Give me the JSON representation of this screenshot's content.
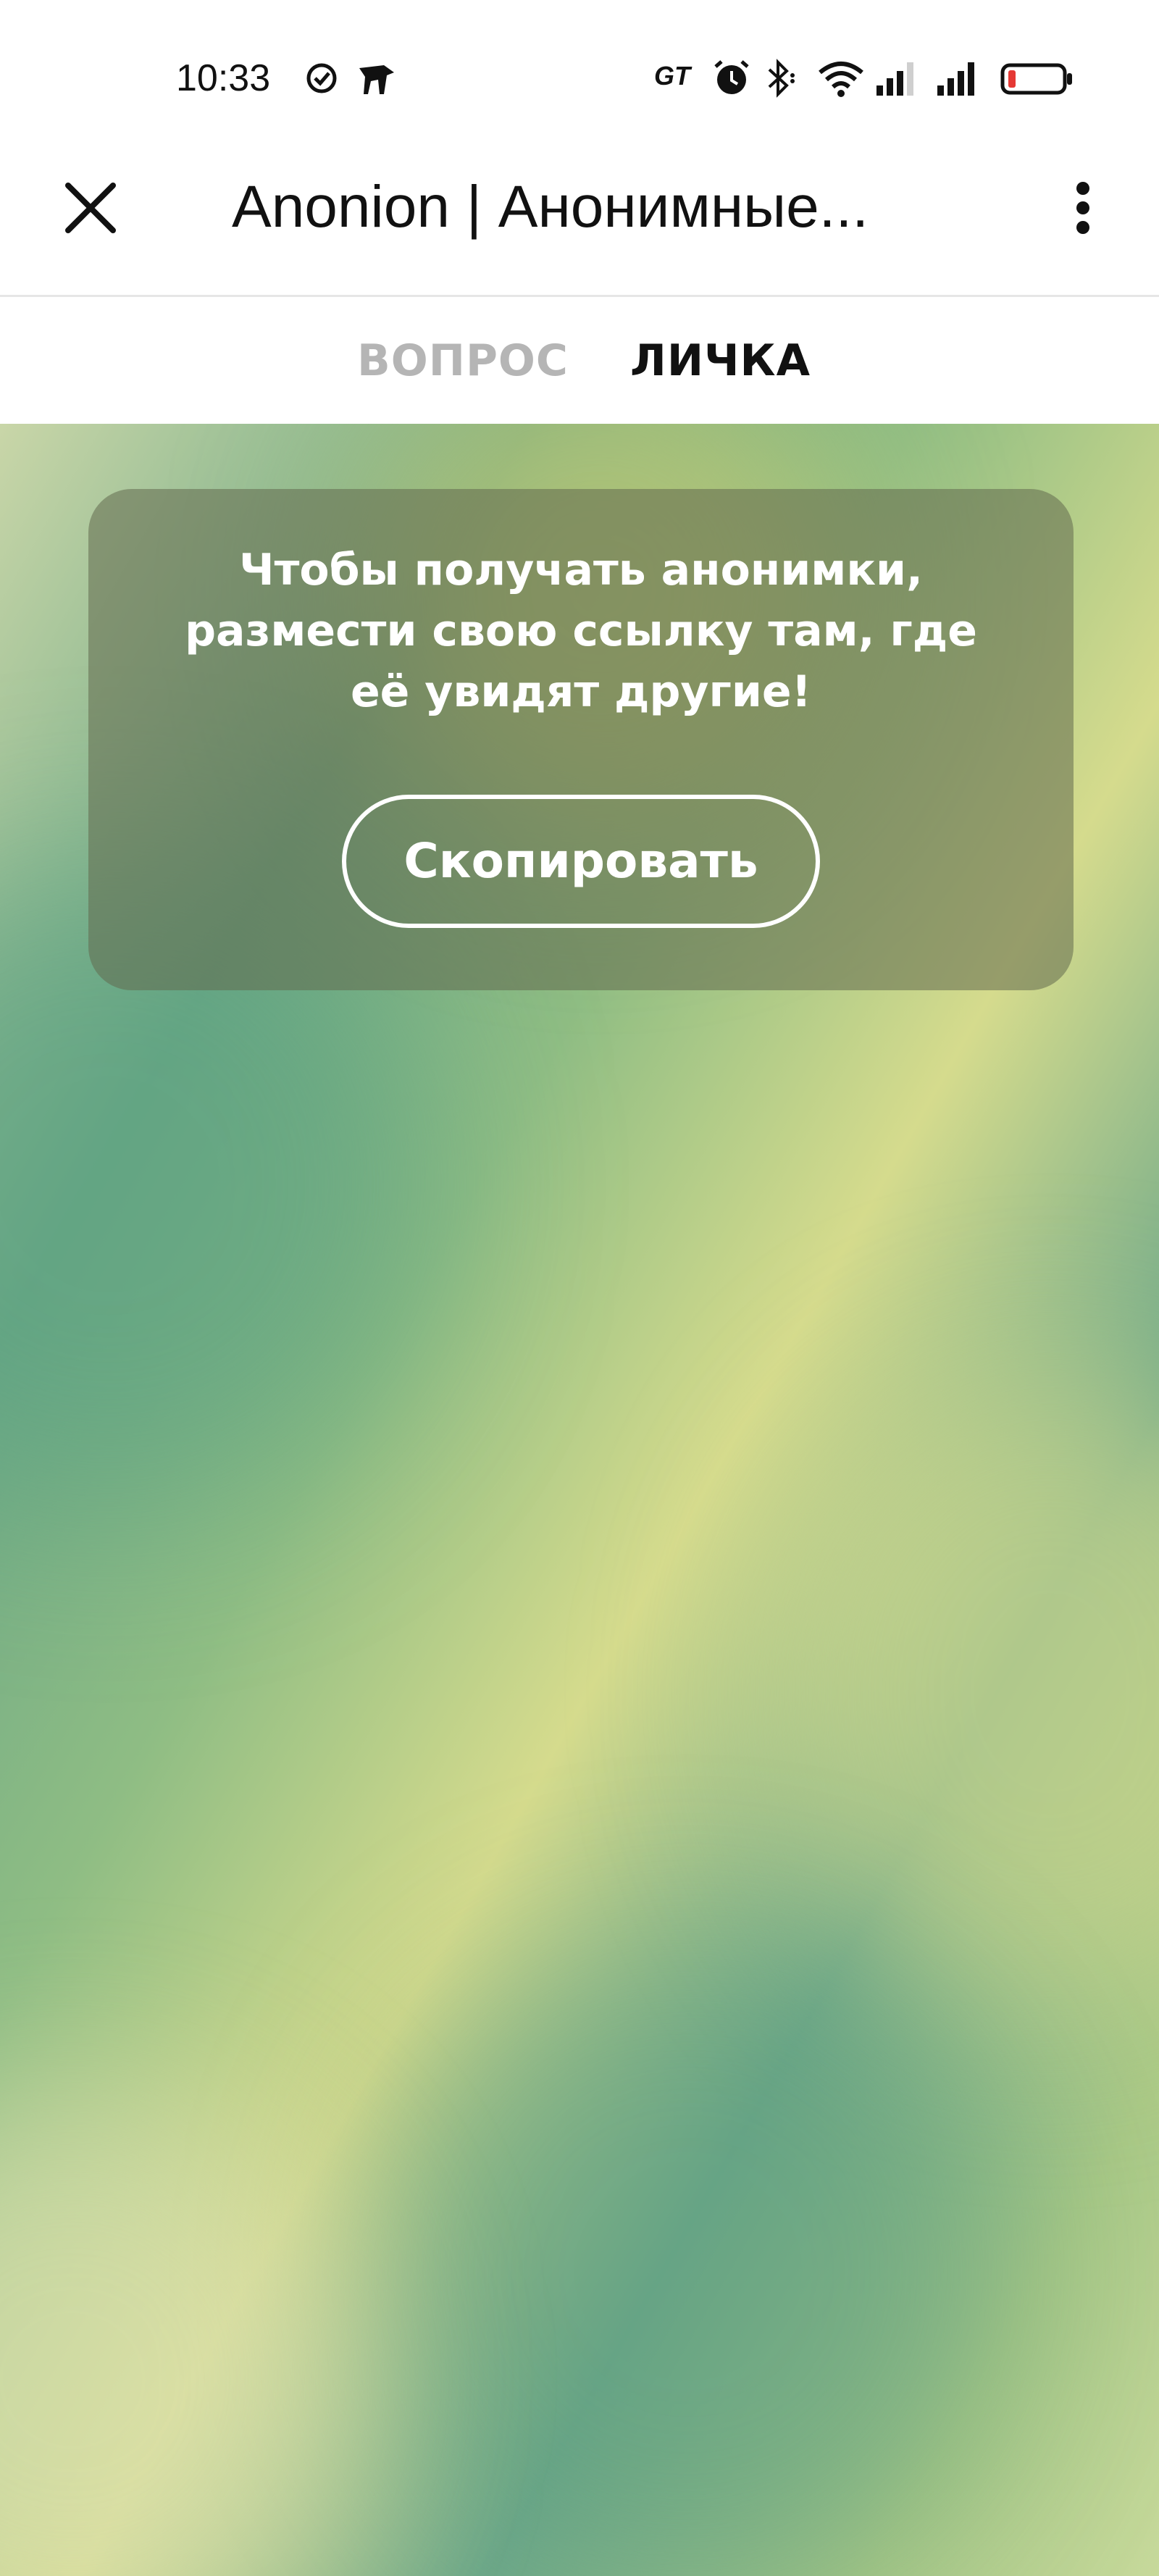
{
  "status_bar": {
    "time": "10:33",
    "network_label": "GT",
    "icons": [
      "check-circle-icon",
      "pet-icon",
      "alarm-icon",
      "bluetooth-icon",
      "wifi-icon",
      "signal-icon",
      "signal-icon",
      "battery-low-icon"
    ]
  },
  "header": {
    "title": "Anonion | Анонимные...",
    "close_icon": "close-icon",
    "menu_icon": "more-vertical-icon"
  },
  "tabs": [
    {
      "label": "ВОПРОС",
      "active": false
    },
    {
      "label": "ЛИЧКА",
      "active": true
    }
  ],
  "card": {
    "lines": [
      "Чтобы получать анонимки,",
      "размести свою ссылку там, где",
      "её увидят другие!"
    ],
    "button_label": "Скопировать"
  },
  "colors": {
    "accent": "#111111",
    "inactive_tab": "#b5b5b5",
    "card_bg": "#6b7152",
    "button_border": "#ffffff"
  }
}
